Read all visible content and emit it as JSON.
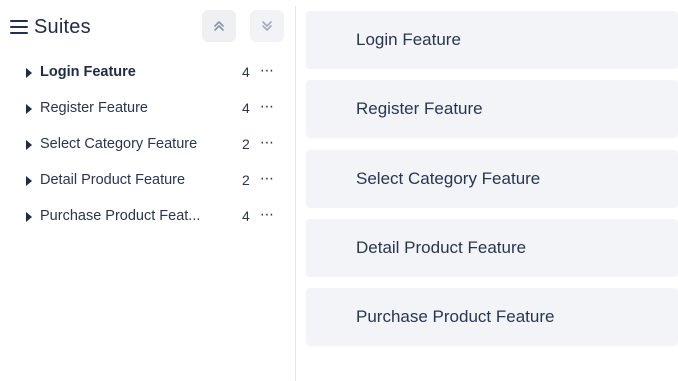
{
  "sidebar": {
    "title": "Suites",
    "expand_all_icon": "chevrons-up-icon",
    "collapse_all_icon": "chevrons-down-icon",
    "suites": [
      {
        "name": "Login Feature",
        "count": "4",
        "more": "⋯",
        "active": true
      },
      {
        "name": "Register Feature",
        "count": "4",
        "more": "⋯",
        "active": false
      },
      {
        "name": "Select Category Feature",
        "count": "2",
        "more": "⋯",
        "active": false
      },
      {
        "name": "Detail Product Feature",
        "count": "2",
        "more": "⋯",
        "active": false
      },
      {
        "name": "Purchase Product Feat...",
        "count": "4",
        "more": "⋯",
        "active": false
      }
    ]
  },
  "main": {
    "sections": [
      {
        "label": "Login Feature"
      },
      {
        "label": "Register Feature"
      },
      {
        "label": "Select Category Feature"
      },
      {
        "label": "Detail Product Feature"
      },
      {
        "label": "Purchase Product Feature"
      }
    ]
  },
  "colors": {
    "text": "#1f2a44",
    "card_bg": "#f3f4f7",
    "button_bg": "#eef0f4"
  }
}
